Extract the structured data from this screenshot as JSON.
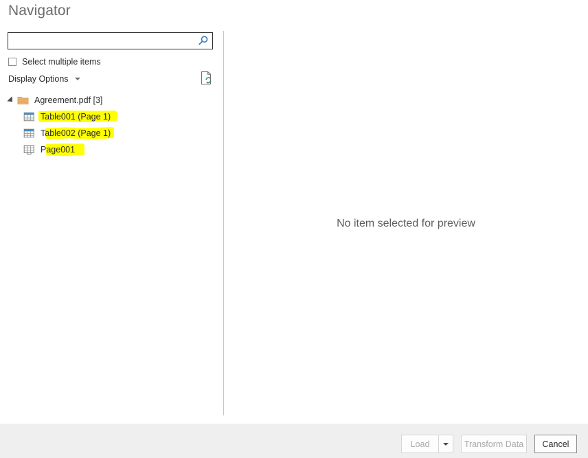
{
  "dialog": {
    "title": "Navigator"
  },
  "search": {
    "value": "",
    "placeholder": "",
    "icon": "search-icon"
  },
  "options": {
    "select_multiple_label": "Select multiple items",
    "select_multiple_checked": false,
    "display_options_label": "Display Options",
    "dropdown_icon": "chevron-down-icon",
    "refresh_icon": "refresh-document-icon"
  },
  "tree": {
    "root": {
      "label": "Agreement.pdf [3]",
      "icon": "pdf-folder-icon",
      "expanded": true,
      "expander_icon": "expander-triangle-icon"
    },
    "children": [
      {
        "label": "Table001 (Page 1)",
        "icon": "table-icon",
        "highlighted": true
      },
      {
        "label": "Table002 (Page 1)",
        "icon": "table-icon",
        "highlighted": true
      },
      {
        "label": "Page001",
        "icon": "page-grid-icon",
        "highlighted": true
      }
    ]
  },
  "preview": {
    "message": "No item selected for preview"
  },
  "footer": {
    "load_label": "Load",
    "load_enabled": false,
    "load_dropdown_icon": "chevron-down-icon",
    "transform_label": "Transform Data",
    "transform_enabled": false,
    "cancel_label": "Cancel",
    "cancel_enabled": true
  },
  "colors": {
    "title": "#6b6b6b",
    "accent_blue": "#3c7cb5",
    "highlight_yellow": "#ffff00",
    "pdf_icon_orange": "#e8a55c",
    "footer_bg": "#efefef",
    "divider": "#c6c6c6"
  }
}
